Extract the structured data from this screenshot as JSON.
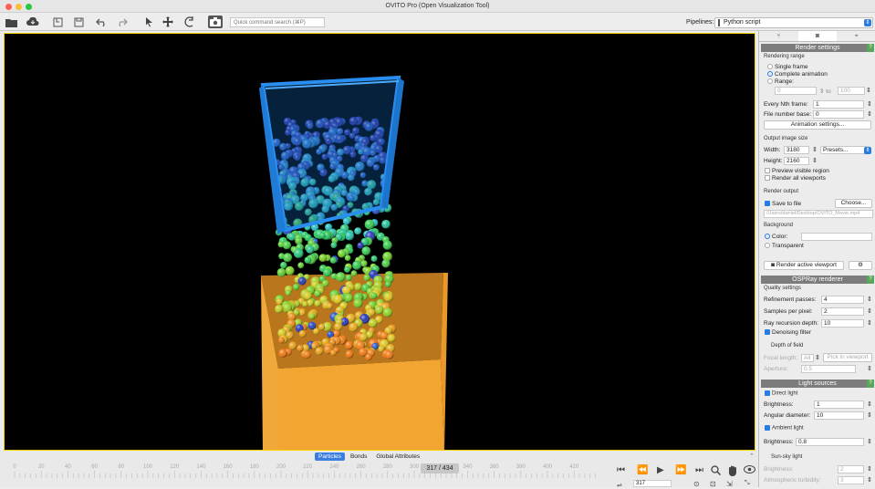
{
  "window": {
    "title": "OVITO Pro (Open Visualization Tool)"
  },
  "toolbar": {
    "search_placeholder": "Quick command search (⌘P)",
    "pipelines_label": "Pipelines:",
    "pipeline_value": "Python script"
  },
  "data_tabs": {
    "items": [
      "Particles",
      "Bonds",
      "Global Attributes"
    ],
    "active": "Particles"
  },
  "timeline": {
    "ticks": [
      "0",
      "20",
      "40",
      "60",
      "80",
      "100",
      "120",
      "140",
      "160",
      "180",
      "200",
      "220",
      "240",
      "260",
      "280",
      "300",
      "320",
      "340",
      "360",
      "380",
      "400",
      "420"
    ],
    "frame_display": "317 / 434"
  },
  "animation": {
    "frame_value": "317"
  },
  "panel": {
    "render_settings": {
      "header": "Render settings",
      "rendering_range": "Rendering range",
      "single_frame": "Single frame",
      "complete_animation": "Complete animation",
      "range": "Range:",
      "range_from": "0",
      "to": "to",
      "range_to": "100",
      "every_nth_label": "Every Nth frame:",
      "every_nth_value": "1",
      "file_base_label": "File number base:",
      "file_base_value": "0",
      "animation_settings_button": "Animation settings...",
      "output_size": "Output image size",
      "width_label": "Width:",
      "width_value": "3180",
      "height_label": "Height:",
      "height_value": "2160",
      "presets": "Presets...",
      "preview_region": "Preview visible region",
      "render_all": "Render all viewports",
      "render_output": "Render output",
      "save_to_file": "Save to file",
      "choose": "Choose...",
      "output_path": "/Users/daniel/Desktop/OVITO_Movie.mp4",
      "background": "Background",
      "color": "Color:",
      "transparent": "Transparent",
      "render_button": "Render active viewport"
    },
    "ospray": {
      "header": "OSPRay renderer",
      "quality": "Quality settings",
      "refinement_label": "Refinement passes:",
      "refinement_value": "4",
      "samples_label": "Samples per pixel:",
      "samples_value": "2",
      "recursion_label": "Ray recursion depth:",
      "recursion_value": "10",
      "denoising": "Denoising filter",
      "dof": "Depth of field",
      "focal_label": "Focal length:",
      "focal_value": "All",
      "pick_button": "Pick in viewport",
      "aperture_label": "Aperture:",
      "aperture_value": "0.5"
    },
    "lights": {
      "header": "Light sources",
      "direct": "Direct light",
      "brightness_label": "Brightness:",
      "brightness_value": "1",
      "angular_label": "Angular diameter:",
      "angular_value": "10",
      "ambient": "Ambient light",
      "ambient_brightness_label": "Brightness:",
      "ambient_brightness_value": "0.8",
      "sunsky": "Sun-sky light",
      "sunsky_brightness_label": "Brightness:",
      "sunsky_brightness_value": "2",
      "turbidity_label": "Atmospheric turbidity:",
      "turbidity_value": "3"
    }
  }
}
